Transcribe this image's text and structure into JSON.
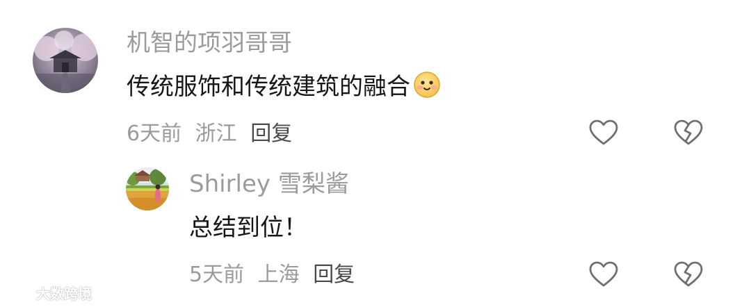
{
  "comments": [
    {
      "username": "机智的项羽哥哥",
      "text": "传统服饰和传统建筑的融合",
      "emoji": "blushing-smile-emoji",
      "time": "6天前",
      "location": "浙江",
      "reply_label": "回复",
      "avatar": "cherry-blossom-temple-avatar"
    },
    {
      "username": "Shirley 雪梨酱",
      "text": "总结到位！",
      "time": "5天前",
      "location": "上海",
      "reply_label": "回复",
      "avatar": "flower-field-avatar"
    }
  ],
  "icons": {
    "like": "heart-outline-icon",
    "dislike": "broken-heart-icon"
  },
  "watermark": {
    "text": "大数跨境",
    "logo": "watermark-logo"
  },
  "colors": {
    "username": "#9b9b9b",
    "text": "#161616",
    "meta": "#9b9b9b",
    "reply": "#4a4a4a",
    "icon_stroke": "#6f6f6f"
  }
}
